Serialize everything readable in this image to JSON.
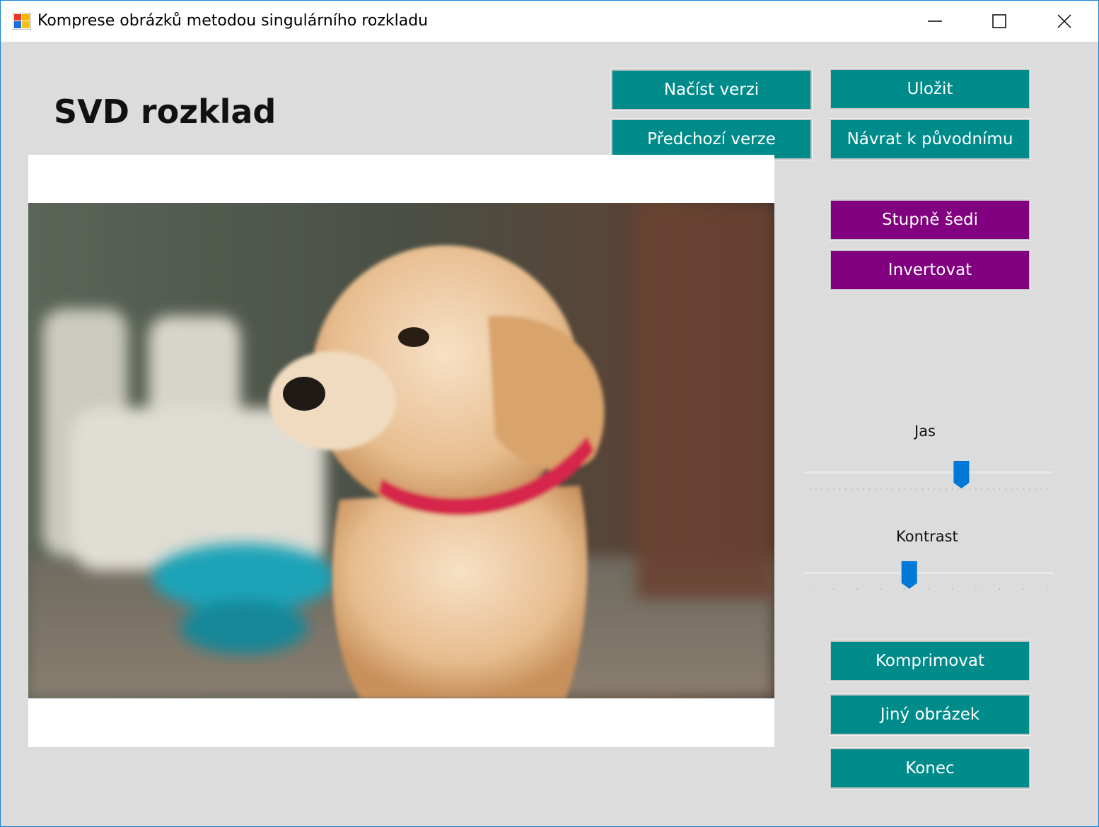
{
  "window": {
    "title": "Komprese obrázků metodou singulárního rozkladu"
  },
  "heading": "SVD rozklad",
  "buttons": {
    "load_version": "Načíst verzi",
    "save": "Uložit",
    "previous_version": "Předchozí verze",
    "restore_original": "Návrat k původnímu",
    "grayscale": "Stupně šedi",
    "invert": "Invertovat",
    "compress": "Komprimovat",
    "other_image": "Jiný obrázek",
    "quit": "Konec"
  },
  "sliders": {
    "brightness": {
      "label": "Jas",
      "value": 0.64
    },
    "contrast": {
      "label": "Kontrast",
      "value": 0.42
    }
  },
  "colors": {
    "teal": "#008b8b",
    "purple": "#800080",
    "slider_thumb": "#0078d7"
  }
}
